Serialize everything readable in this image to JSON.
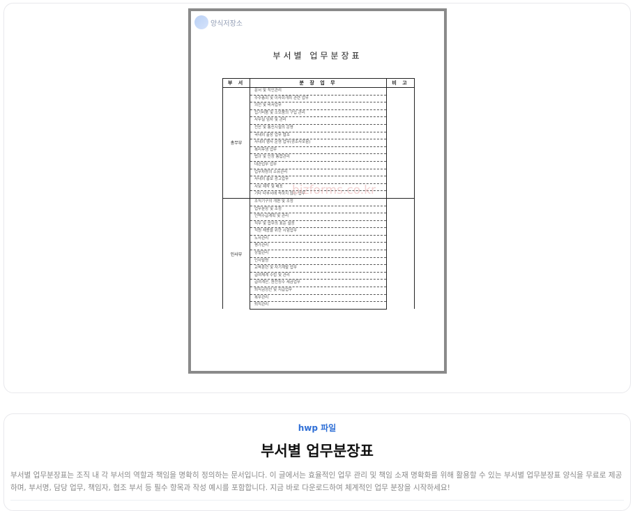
{
  "preview": {
    "logo_text": "양식저장소",
    "watermark": "bizforms.co.kr",
    "doc_title": "부서별 업무분장표",
    "table": {
      "headers": {
        "dept": "부 서",
        "duty": "분 장 업 무",
        "note": "비 고"
      },
      "groups": [
        {
          "dept": "총무부",
          "duties": [
            "문서 및 직인관리",
            "주주총회 및 이사회개최 관련 업무",
            "의전 및 비서업무",
            "집기비품 및 소모품의 구입 관리",
            "사무실 임차 및 관리",
            "전산 및 통신시설의 운영",
            "국내외 출장 업무 협조",
            "사내외 행사 운영 업무(경조사포함)",
            "복리후생 업무",
            "법규 및 인장 통합관리",
            "대관업무 업무",
            "업무차량의 소유관리",
            "사내외 홍보 광고업무",
            "사보 제작 및 배포",
            "기타 타부서에 속하지 않는 업무"
          ]
        },
        {
          "dept": "인사부",
          "duties": [
            "조직기구의 개편 및 조정",
            "업무분장 및 조정",
            "인력수급계획 및 관리",
            "직무 및 업무의 표준 설정",
            "직원 채용을 위한 시험업무",
            "노사관리",
            "평가관리",
            "상벌관리",
            "인사발령",
            "교육훈련 및 자기계발 업무",
            "급여체계 수립 및 관리",
            "급여계산, 원천징수 세금업무",
            "퇴직금정산 및 지급업무",
            "복무관리",
            "퇴직관리"
          ]
        }
      ]
    }
  },
  "info": {
    "file_type": "hwp 파일",
    "title": "부서별 업무분장표",
    "description": "부서별 업무분장표는 조직 내 각 부서의 역할과 책임을 명확히 정의하는 문서입니다. 이 글에서는 효율적인 업무 관리 및 책임 소재 명확화를 위해 활용할 수 있는 부서별 업무분장표 양식을 무료로 제공하며, 부서명, 담당 업무, 책임자, 협조 부서 등 필수 항목과 작성 예시를 포함합니다. 지금 바로 다운로드하여 체계적인 업무 분장을 시작하세요!"
  }
}
